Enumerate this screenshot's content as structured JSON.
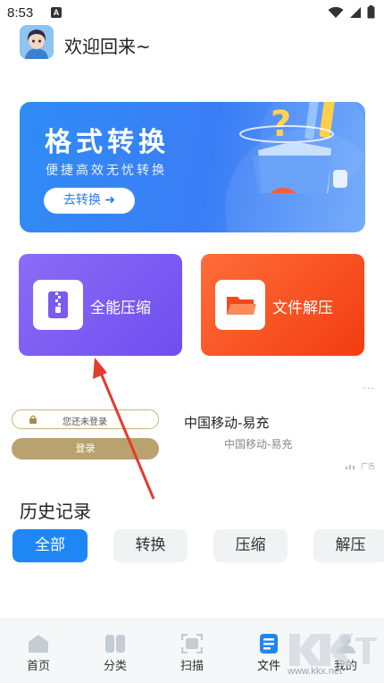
{
  "status_bar": {
    "time": "8:53",
    "notification_letter": "A"
  },
  "header": {
    "welcome_text": "欢迎回来~"
  },
  "banner": {
    "title": "格式转换",
    "subtitle": "便捷高效无忧转换",
    "button_label": "去转换 ➜"
  },
  "features": {
    "compress_label": "全能压缩",
    "extract_label": "文件解压"
  },
  "ad": {
    "login_notice": "您还未登录",
    "login_button": "登录",
    "title": "中国移动-易充",
    "subtitle": "中国移动-易充",
    "more": "···",
    "tag": "广告"
  },
  "history": {
    "title": "历史记录",
    "tabs": [
      "全部",
      "转换",
      "压缩",
      "解压"
    ],
    "active_tab": "全部"
  },
  "bottom_nav": {
    "items": [
      "首页",
      "分类",
      "扫描",
      "文件",
      "我的"
    ],
    "active": "文件"
  },
  "watermark": {
    "text": "www.kkx.net"
  },
  "colors": {
    "accent_blue": "#1f86f5",
    "compress_card": "#7b5cf2",
    "extract_card": "#f5501c",
    "annotation_arrow": "#e53a2f"
  }
}
